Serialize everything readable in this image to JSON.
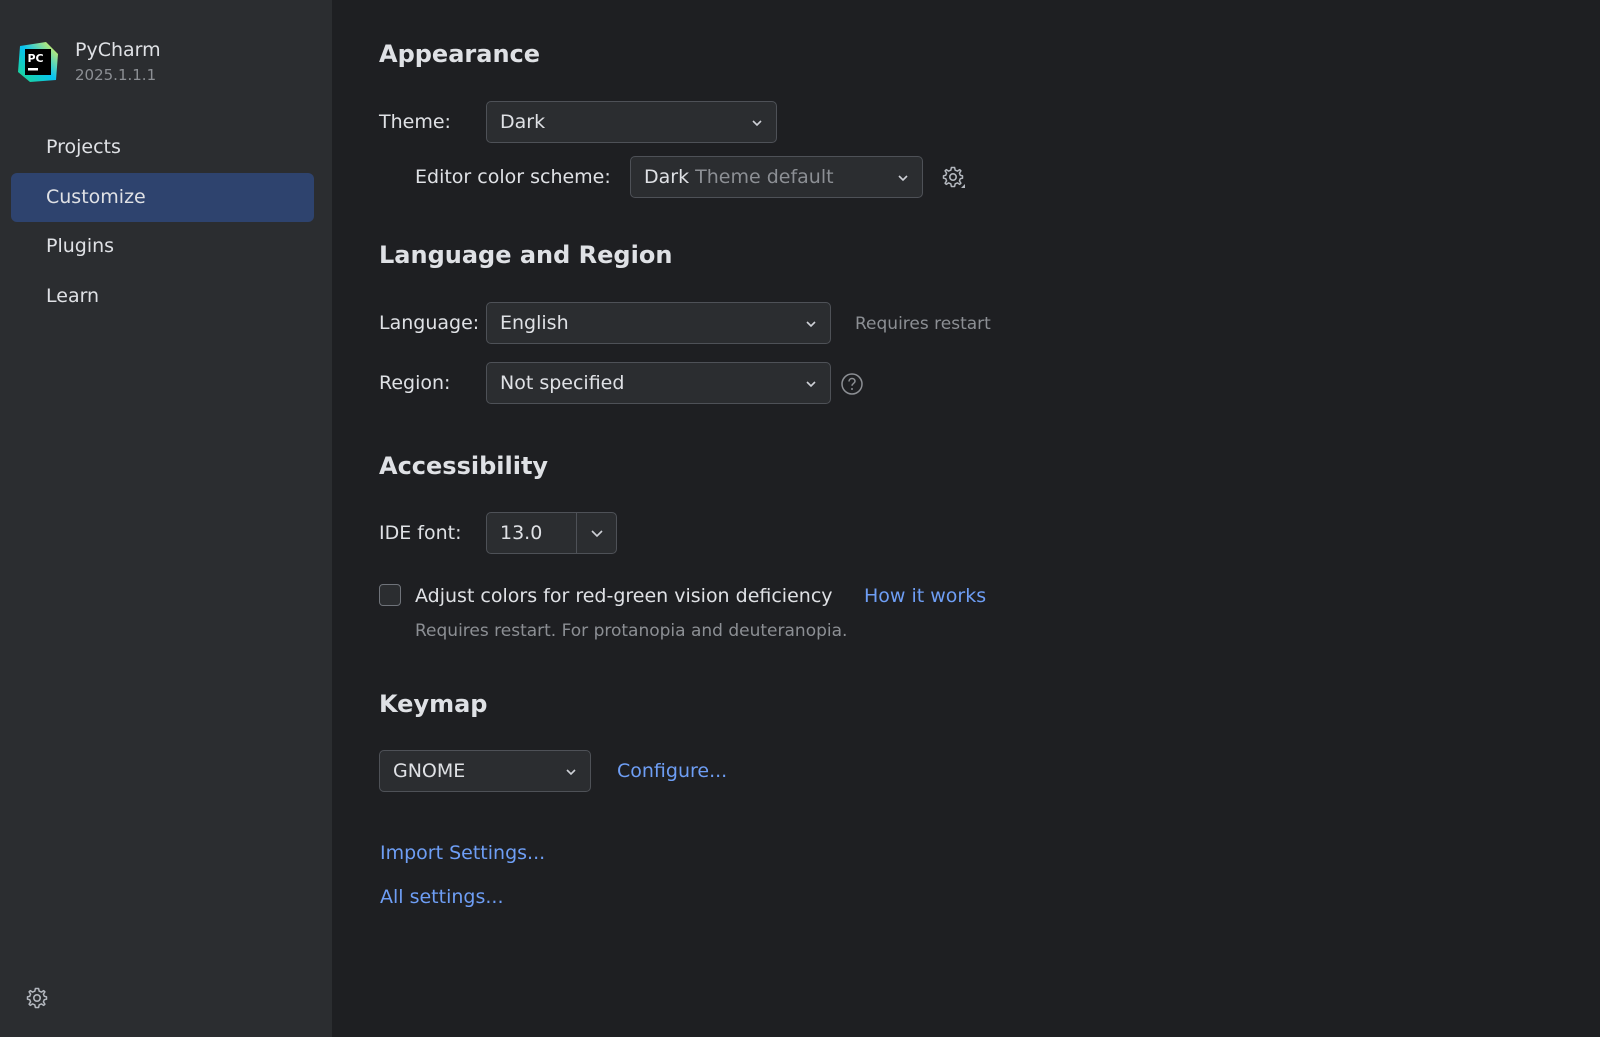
{
  "app": {
    "name": "PyCharm",
    "version": "2025.1.1.1",
    "logo_text": "PC"
  },
  "sidebar": {
    "items": [
      {
        "label": "Projects",
        "active": false
      },
      {
        "label": "Customize",
        "active": true
      },
      {
        "label": "Plugins",
        "active": false
      },
      {
        "label": "Learn",
        "active": false
      }
    ],
    "settings_icon": "gear-icon"
  },
  "appearance": {
    "title": "Appearance",
    "theme_label": "Theme:",
    "theme_value": "Dark",
    "scheme_label": "Editor color scheme:",
    "scheme_value": "Dark",
    "scheme_suffix": "Theme default"
  },
  "language_region": {
    "title": "Language and Region",
    "language_label": "Language:",
    "language_value": "English",
    "language_hint": "Requires restart",
    "region_label": "Region:",
    "region_value": "Not specified"
  },
  "accessibility": {
    "title": "Accessibility",
    "font_label": "IDE font:",
    "font_value": "13.0",
    "color_adjust_label": "Adjust colors for red-green vision deficiency",
    "color_adjust_checked": false,
    "how_it_works": "How it works",
    "color_adjust_hint": "Requires restart. For protanopia and deuteranopia."
  },
  "keymap": {
    "title": "Keymap",
    "value": "GNOME",
    "configure": "Configure..."
  },
  "links": {
    "import_settings": "Import Settings...",
    "all_settings": "All settings..."
  },
  "colors": {
    "accent": "#2e436e",
    "link": "#6e9ef5",
    "background": "#1e1f22",
    "sidebar": "#2b2d30"
  }
}
